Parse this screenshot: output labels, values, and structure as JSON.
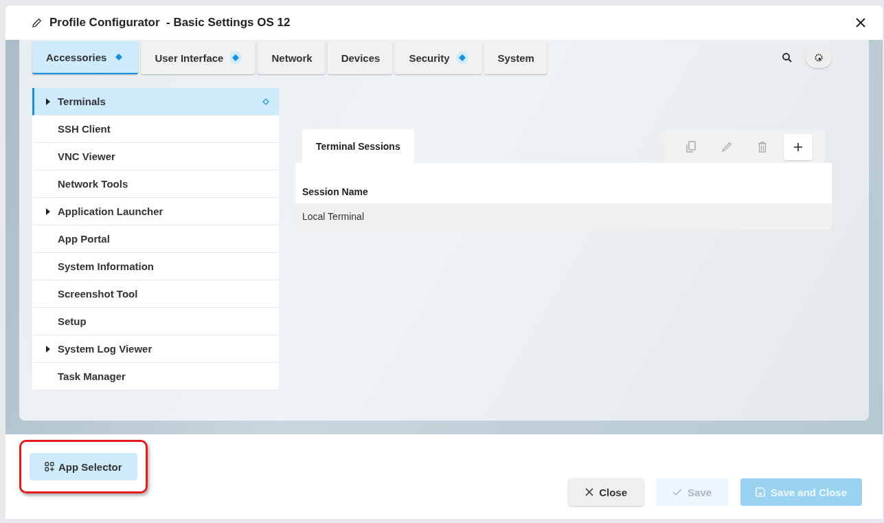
{
  "window": {
    "title": "Profile Configurator  - Basic Settings OS 12"
  },
  "tabs": [
    {
      "label": "Accessories",
      "selected": true,
      "modified": true
    },
    {
      "label": "User Interface",
      "selected": false,
      "modified": true
    },
    {
      "label": "Network",
      "selected": false,
      "modified": false
    },
    {
      "label": "Devices",
      "selected": false,
      "modified": false
    },
    {
      "label": "Security",
      "selected": false,
      "modified": true
    },
    {
      "label": "System",
      "selected": false,
      "modified": false
    }
  ],
  "sidebar": {
    "items": [
      {
        "label": "Terminals",
        "selected": true,
        "expandable": true,
        "modified": true
      },
      {
        "label": "SSH Client",
        "selected": false,
        "expandable": false,
        "modified": false
      },
      {
        "label": "VNC Viewer",
        "selected": false,
        "expandable": false,
        "modified": false
      },
      {
        "label": "Network Tools",
        "selected": false,
        "expandable": false,
        "modified": false
      },
      {
        "label": "Application Launcher",
        "selected": false,
        "expandable": true,
        "modified": false
      },
      {
        "label": "App Portal",
        "selected": false,
        "expandable": false,
        "modified": false
      },
      {
        "label": "System Information",
        "selected": false,
        "expandable": false,
        "modified": false
      },
      {
        "label": "Screenshot Tool",
        "selected": false,
        "expandable": false,
        "modified": false
      },
      {
        "label": "Setup",
        "selected": false,
        "expandable": false,
        "modified": false
      },
      {
        "label": "System Log Viewer",
        "selected": false,
        "expandable": true,
        "modified": false
      },
      {
        "label": "Task Manager",
        "selected": false,
        "expandable": false,
        "modified": false
      }
    ]
  },
  "panel": {
    "tabs": [
      "Terminal Sessions"
    ],
    "toolbar": [
      {
        "kind": "copy",
        "disabled": true
      },
      {
        "kind": "edit",
        "disabled": true
      },
      {
        "kind": "delete",
        "disabled": true
      },
      {
        "kind": "add",
        "disabled": false
      }
    ],
    "table": {
      "columns": [
        "Session Name"
      ],
      "rows": [
        [
          "Local Terminal"
        ]
      ]
    }
  },
  "footer": {
    "app_selector": {
      "label": "App Selector",
      "highlighted": true
    },
    "buttons": [
      {
        "kind": "close",
        "label": "Close",
        "disabled": false
      },
      {
        "kind": "save",
        "label": "Save",
        "disabled": true
      },
      {
        "kind": "save_close",
        "label": "Save and Close",
        "disabled": true
      }
    ]
  }
}
